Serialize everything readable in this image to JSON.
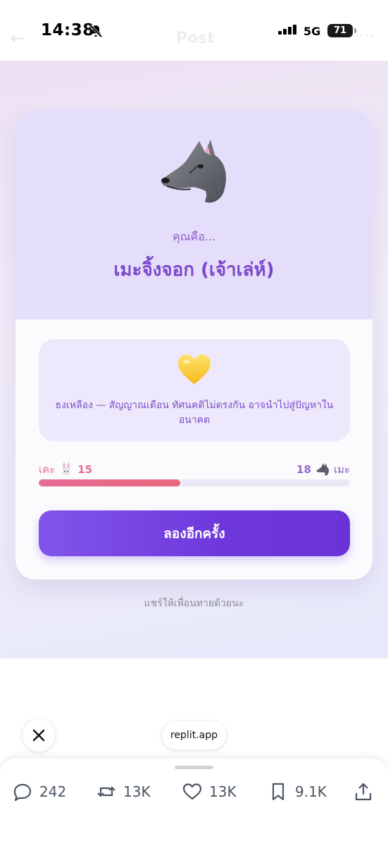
{
  "status_bar": {
    "time": "14:38",
    "network": "5G",
    "battery": "71",
    "behind_title": "Post"
  },
  "quiz": {
    "subtitle": "คุณคือ...",
    "result_title": "เมะจิ้งจอก (เจ้าเล่ห์)",
    "result_icon": "wolf-emoji-icon",
    "flag_icon": "yellow-heart-icon",
    "flag_text": "ธงเหลือง — สัญญาณเตือน ทัศนคติไม่ตรงกัน อาจนำไปสู่ปัญหาในอนาคต",
    "score": {
      "left_label": "เคะ",
      "left_value": "15",
      "right_label": "เมะ",
      "right_value": "18",
      "left_fraction": 0.455
    },
    "retry_label": "ลองอีกครั้ง",
    "share_hint": "แชร์ให้เพื่อนทายด้วยนะ"
  },
  "overlay": {
    "url": "replit.app"
  },
  "actions": {
    "replies": "242",
    "reposts": "13K",
    "likes": "13K",
    "bookmarks": "9.1K"
  },
  "colors": {
    "accent": "#7c47c9",
    "button": "#6e37dc",
    "progress": "#e86b95"
  }
}
